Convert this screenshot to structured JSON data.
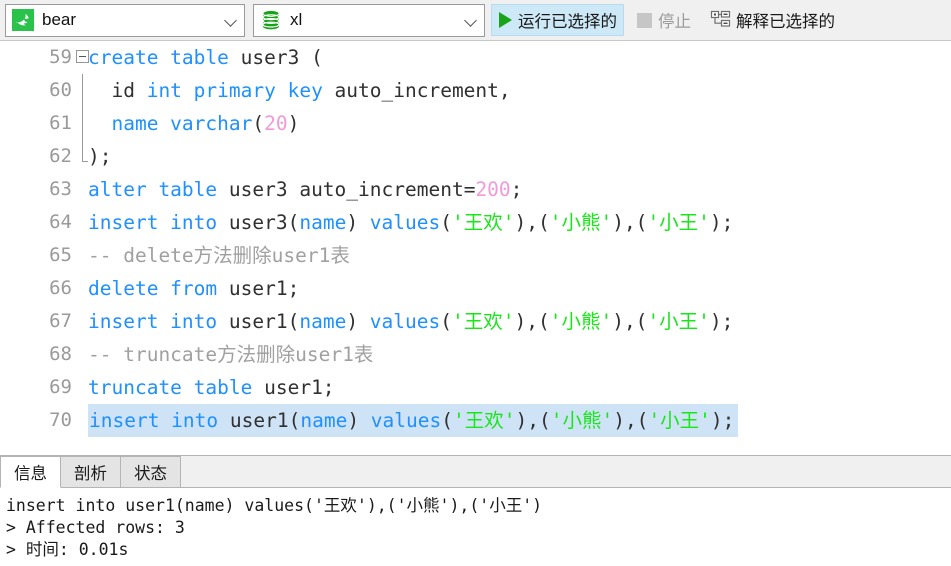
{
  "toolbar": {
    "connection": {
      "icon": "mysql-dolphin-icon",
      "value": "bear"
    },
    "database": {
      "icon": "database-icon",
      "value": "xl"
    },
    "run_selected": {
      "icon": "play-icon",
      "label": "运行已选择的"
    },
    "stop": {
      "icon": "stop-icon",
      "label": "停止"
    },
    "explain_selected": {
      "icon": "explain-plan-icon",
      "label": "解释已选择的"
    }
  },
  "editor": {
    "lines": [
      {
        "no": "59",
        "fold": "start",
        "tokens": [
          {
            "t": "create table ",
            "c": "kw"
          },
          {
            "t": "user3 (",
            "c": "pl"
          }
        ]
      },
      {
        "no": "60",
        "fold": "mid",
        "tokens": [
          {
            "t": "  id ",
            "c": "pl"
          },
          {
            "t": "int primary key ",
            "c": "kw"
          },
          {
            "t": "auto_increment,",
            "c": "pl"
          }
        ]
      },
      {
        "no": "61",
        "fold": "mid",
        "tokens": [
          {
            "t": "  ",
            "c": "pl"
          },
          {
            "t": "name varchar",
            "c": "kw"
          },
          {
            "t": "(",
            "c": "pl"
          },
          {
            "t": "20",
            "c": "num"
          },
          {
            "t": ")",
            "c": "pl"
          }
        ]
      },
      {
        "no": "62",
        "fold": "end",
        "tokens": [
          {
            "t": ");",
            "c": "pl"
          }
        ]
      },
      {
        "no": "63",
        "fold": "none",
        "tokens": [
          {
            "t": "alter table ",
            "c": "kw"
          },
          {
            "t": "user3 auto_increment=",
            "c": "pl"
          },
          {
            "t": "200",
            "c": "num"
          },
          {
            "t": ";",
            "c": "pl"
          }
        ]
      },
      {
        "no": "64",
        "fold": "none",
        "tokens": [
          {
            "t": "insert into ",
            "c": "kw"
          },
          {
            "t": "user3(",
            "c": "pl"
          },
          {
            "t": "name",
            "c": "kw"
          },
          {
            "t": ") ",
            "c": "pl"
          },
          {
            "t": "values",
            "c": "kw"
          },
          {
            "t": "(",
            "c": "pl"
          },
          {
            "t": "'王欢'",
            "c": "str"
          },
          {
            "t": "),(",
            "c": "pl"
          },
          {
            "t": "'小熊'",
            "c": "str"
          },
          {
            "t": "),(",
            "c": "pl"
          },
          {
            "t": "'小王'",
            "c": "str"
          },
          {
            "t": ");",
            "c": "pl"
          }
        ]
      },
      {
        "no": "65",
        "fold": "none",
        "tokens": [
          {
            "t": "-- delete方法删除user1表",
            "c": "cmt"
          }
        ]
      },
      {
        "no": "66",
        "fold": "none",
        "tokens": [
          {
            "t": "delete from ",
            "c": "kw"
          },
          {
            "t": "user1;",
            "c": "pl"
          }
        ]
      },
      {
        "no": "67",
        "fold": "none",
        "tokens": [
          {
            "t": "insert into ",
            "c": "kw"
          },
          {
            "t": "user1(",
            "c": "pl"
          },
          {
            "t": "name",
            "c": "kw"
          },
          {
            "t": ") ",
            "c": "pl"
          },
          {
            "t": "values",
            "c": "kw"
          },
          {
            "t": "(",
            "c": "pl"
          },
          {
            "t": "'王欢'",
            "c": "str"
          },
          {
            "t": "),(",
            "c": "pl"
          },
          {
            "t": "'小熊'",
            "c": "str"
          },
          {
            "t": "),(",
            "c": "pl"
          },
          {
            "t": "'小王'",
            "c": "str"
          },
          {
            "t": ");",
            "c": "pl"
          }
        ]
      },
      {
        "no": "68",
        "fold": "none",
        "tokens": [
          {
            "t": "-- truncate方法删除user1表",
            "c": "cmt"
          }
        ]
      },
      {
        "no": "69",
        "fold": "none",
        "tokens": [
          {
            "t": "truncate table ",
            "c": "kw"
          },
          {
            "t": "user1;",
            "c": "pl"
          }
        ]
      },
      {
        "no": "70",
        "fold": "none",
        "selected": true,
        "tokens": [
          {
            "t": "insert into ",
            "c": "kw"
          },
          {
            "t": "user1(",
            "c": "pl"
          },
          {
            "t": "name",
            "c": "kw"
          },
          {
            "t": ") ",
            "c": "pl"
          },
          {
            "t": "values",
            "c": "kw"
          },
          {
            "t": "(",
            "c": "pl"
          },
          {
            "t": "'王欢'",
            "c": "str"
          },
          {
            "t": "),(",
            "c": "pl"
          },
          {
            "t": "'小熊'",
            "c": "str"
          },
          {
            "t": "),(",
            "c": "pl"
          },
          {
            "t": "'小王'",
            "c": "str"
          },
          {
            "t": ");",
            "c": "pl"
          }
        ]
      }
    ]
  },
  "bottom": {
    "tabs": [
      {
        "label": "信息",
        "active": true
      },
      {
        "label": "剖析",
        "active": false
      },
      {
        "label": "状态",
        "active": false
      }
    ],
    "console_lines": [
      "insert into user1(name) values('王欢'),('小熊'),('小王')",
      "> Affected rows: 3",
      "> 时间: 0.01s"
    ]
  },
  "colors": {
    "keyword": "#1e90ff",
    "string": "#19e619",
    "number": "#f29ad8",
    "comment": "#a0a0a0",
    "selection": "#cfe3f7",
    "accent_green": "#29c24a",
    "toolbar_bg": "#f0f0f0"
  }
}
